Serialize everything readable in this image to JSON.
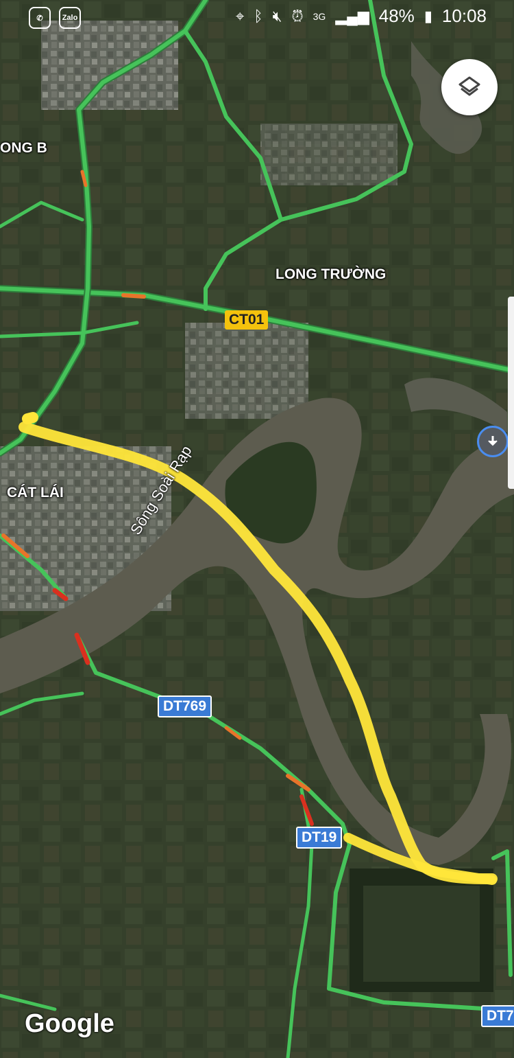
{
  "status_bar": {
    "app_icons": [
      "messenger-icon",
      "zalo-icon"
    ],
    "zalo_label": "Zalo",
    "network": "3G",
    "battery": "48%",
    "time": "10:08"
  },
  "map": {
    "places": {
      "long_b": "ONG B",
      "long_truong": "LONG TRƯỜNG",
      "cat_lai": "CÁT LÁI"
    },
    "roads": {
      "ct01": "CT01",
      "dt769": "DT769",
      "dt19": "DT19",
      "dt7": "DT7"
    },
    "river": "Sông Soài Rạp",
    "attribution": "Google",
    "colors": {
      "traffic_green": "#46c35a",
      "traffic_orange": "#e8742a",
      "traffic_red": "#d9301f",
      "route_highlight": "#ffe63a",
      "river": "#5d5c4f",
      "shield_yellow": "#f4c20d",
      "shield_blue": "#3a7bd5"
    }
  },
  "controls": {
    "layers_icon": "layers-icon",
    "download_icon": "download-icon"
  }
}
